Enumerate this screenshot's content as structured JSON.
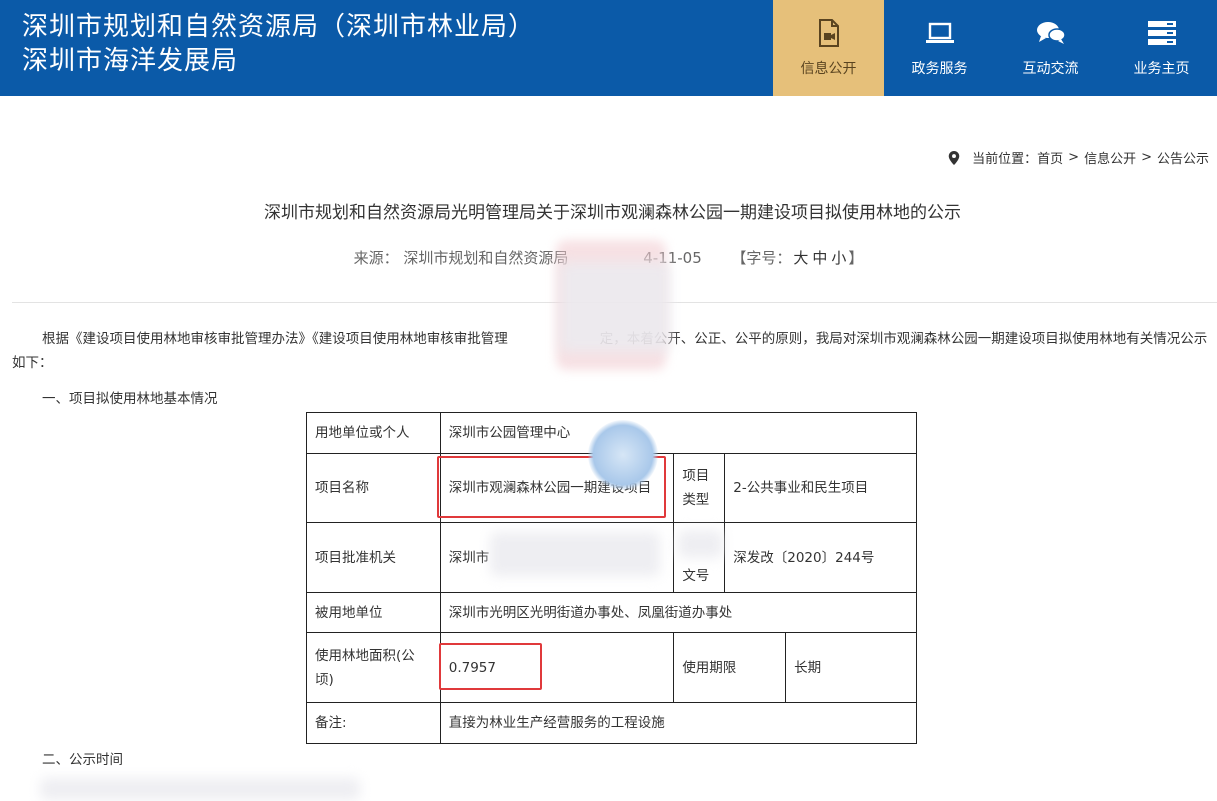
{
  "header": {
    "title_line1": "深圳市规划和自然资源局（深圳市林业局）",
    "title_line2": "深圳市海洋发展局",
    "nav": [
      {
        "label": "信息公开",
        "icon": "document-video-icon",
        "active": true
      },
      {
        "label": "政务服务",
        "icon": "laptop-icon",
        "active": false
      },
      {
        "label": "互动交流",
        "icon": "chat-bubbles-icon",
        "active": false
      },
      {
        "label": "业务主页",
        "icon": "server-icon",
        "active": false
      }
    ]
  },
  "breadcrumb": {
    "prefix": "当前位置：",
    "items": [
      "首页",
      "信息公开",
      "公告公示"
    ],
    "separator": ">"
  },
  "article": {
    "title": "深圳市规划和自然资源局光明管理局关于深圳市观澜森林公园一期建设项目拟使用林地的公示",
    "source_label": "来源：",
    "source_value": "深圳市规划和自然资源局",
    "date": "2024-11-05",
    "date_visible": "4-11-05",
    "font_size_label": "【字号：",
    "font_sizes": [
      "大",
      "中",
      "小"
    ],
    "font_size_close": "】",
    "intro": "根据《建设项目使用林地审核审批管理办法》《建设项目使用林地审核审批管理",
    "intro_tail": "定，本着公开、公正、公平的原则，我局对深圳市观澜森林公园一期建设项目拟使用林地有关情况公示如下：",
    "section1": "一、项目拟使用林地基本情况",
    "section2": "二、公示时间"
  },
  "table": {
    "applicant_label": "用地单位或个人",
    "applicant_value": "深圳市公园管理中心",
    "project_name_label": "项目名称",
    "project_name_value": "深圳市观澜森林公园一期建设项目",
    "project_type_label": "项目类型",
    "project_type_value": "2-公共事业和民生项目",
    "approval_org_label": "项目批准机关",
    "approval_org_value": "深圳市",
    "approval_doc_label": "文号",
    "approval_doc_value": "深发改〔2020〕244号",
    "land_unit_label": "被用地单位",
    "land_unit_value": "深圳市光明区光明街道办事处、凤凰街道办事处",
    "area_label": "使用林地面积(公顷)",
    "area_value": "0.7957",
    "term_label": "使用期限",
    "term_value": "长期",
    "remark_label": "备注:",
    "remark_value": "直接为林业生产经营服务的工程设施"
  },
  "colors": {
    "header_bg": "#0b5aa8",
    "nav_active_bg": "#e6c07a",
    "highlight_box": "#e0393b"
  }
}
